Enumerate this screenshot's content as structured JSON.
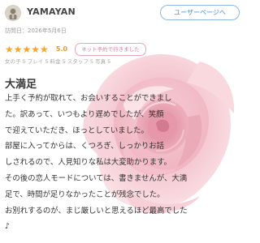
{
  "header": {
    "username": "YAMAYAN",
    "user_page_button": "ユーザーページへ",
    "avatar_icon": "user-avatar-icon"
  },
  "visit_date": "訪問日：2026年5月6日",
  "rating": {
    "stars": "★★★★★",
    "star_count": 5,
    "score": "5.0",
    "net_badge": "ネット予約で行きました",
    "star_color": "#f5a52e"
  },
  "meta_line": "女の子 5 プレイ 5 料金 5 スタッフ 5 写真 5",
  "review": {
    "title": "大満足",
    "lines": [
      "上手く予約が取れて、お会いすることができまし",
      "た。訳あって、いつもより遅めでしたが、笑顔",
      "で迎えていただき、ほっとしていました。",
      "部屋に入ってからは、くつろぎ、しっかりお話",
      "しされるので、人見知りな私は大変助かります。",
      "その後の恋人モードについては、書きませんが、大満",
      "足で、時間が足りなかったことが残念でした。",
      "お別れするのが、まじ厳しいと思えるほど最高でした",
      "♪"
    ]
  },
  "decor": {
    "image": "pink-rose-image",
    "rose_color": "#f2b8c4"
  }
}
